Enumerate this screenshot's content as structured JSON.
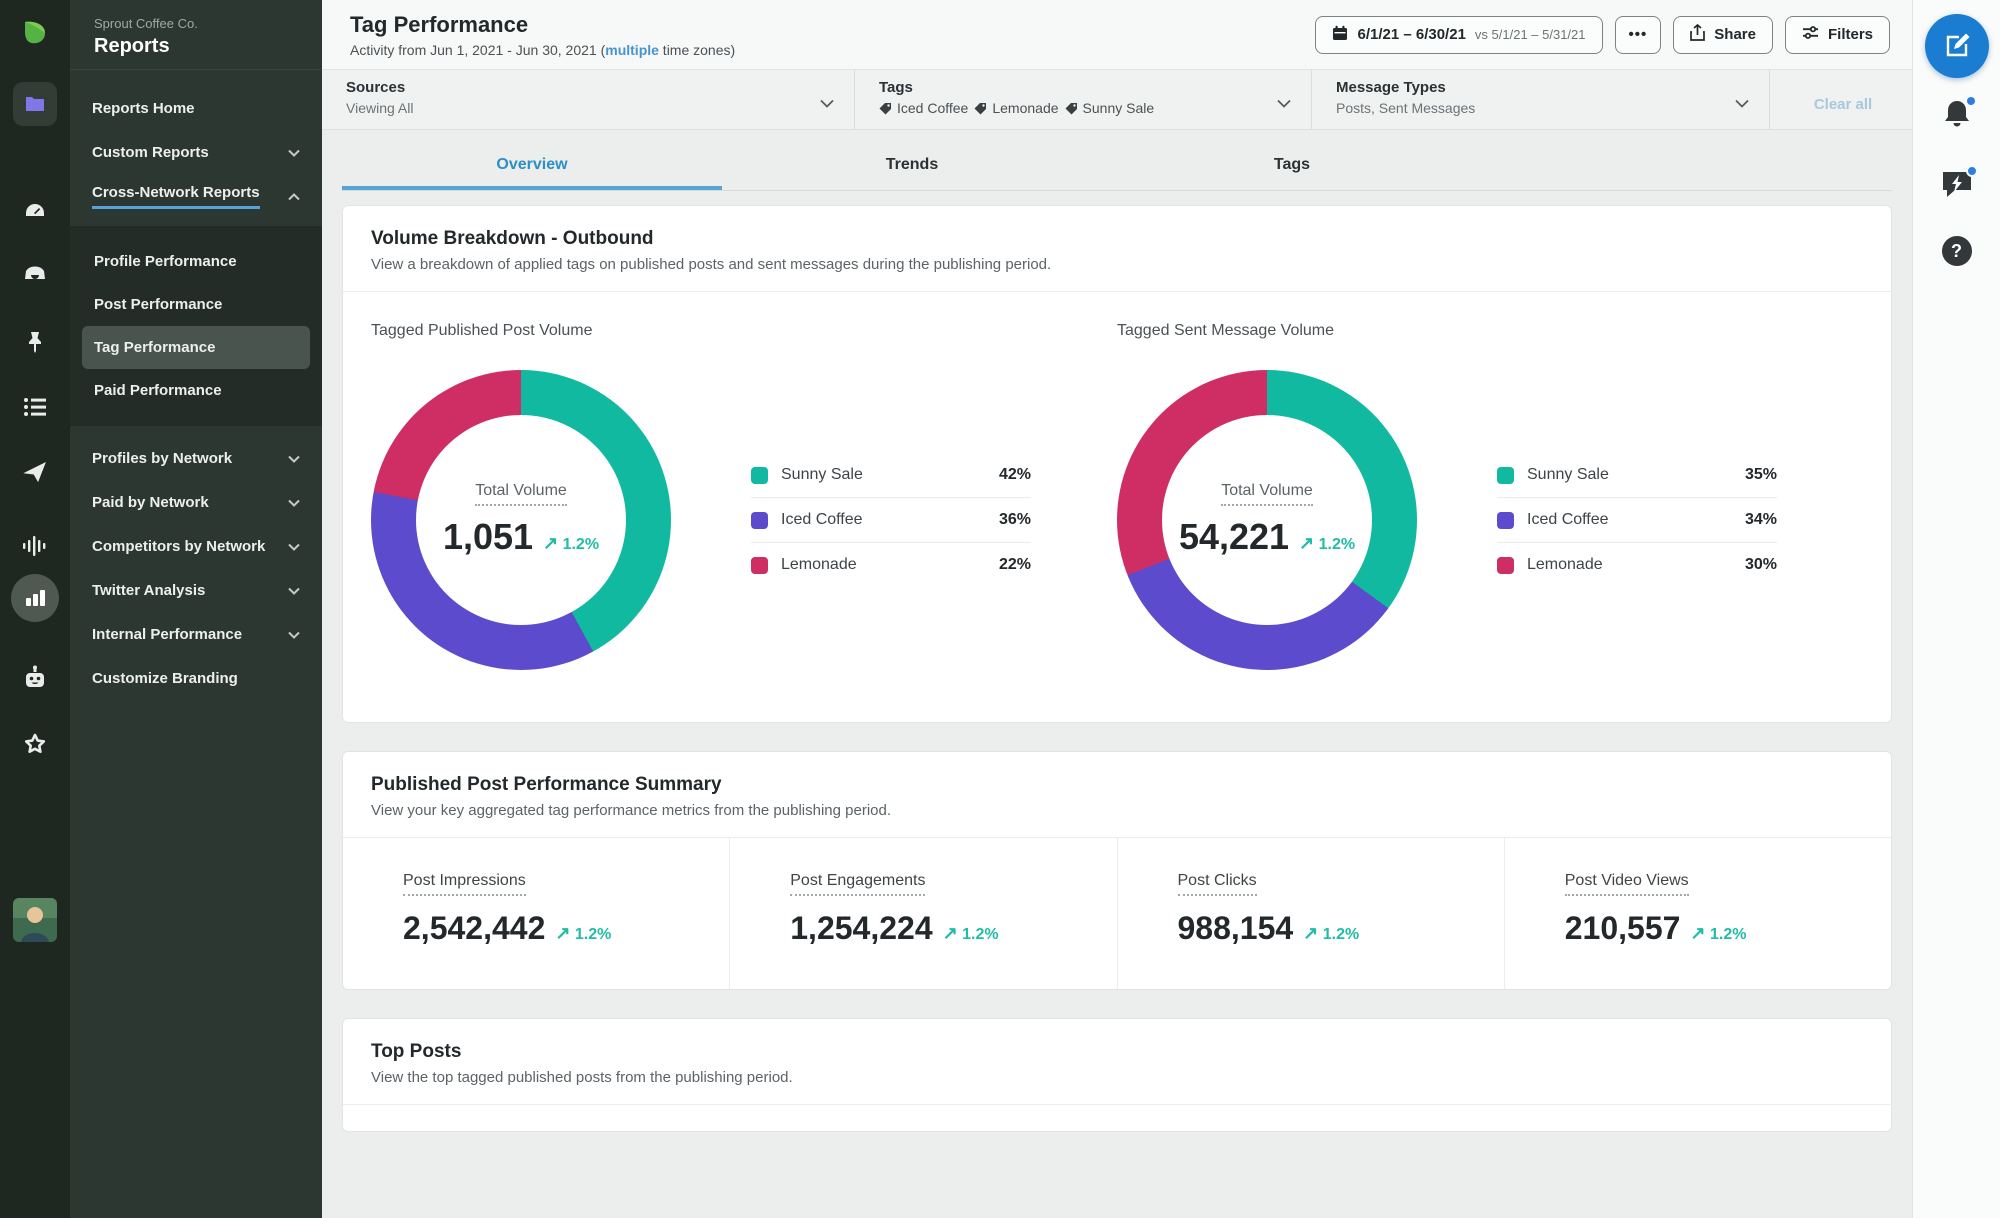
{
  "colors": {
    "teal": "#10B9A0",
    "purple": "#5D4BCD",
    "pink": "#CE2E63",
    "accent_blue": "#2E8FC4",
    "underline_blue": "#54A4D6",
    "link_blue": "#4795CE",
    "compose_blue": "#1A7DD2",
    "delta_teal": "#21BCA5",
    "sidebar_bg": "#2D3731",
    "rail_bg": "#1F2721"
  },
  "icons": {
    "trend_up": "↗",
    "more": "•••"
  },
  "icon_rail": [
    "sprout-logo",
    "folder",
    "gauge",
    "inbox",
    "pin",
    "list",
    "paper-plane",
    "waveform",
    "bar-chart",
    "bot",
    "star",
    "avatar"
  ],
  "sidebar": {
    "company": "Sprout Coffee Co.",
    "title": "Reports",
    "items_top": [
      {
        "label": "Reports Home"
      },
      {
        "label": "Custom Reports"
      },
      {
        "label": "Cross-Network Reports"
      }
    ],
    "sub_items": [
      {
        "label": "Profile Performance"
      },
      {
        "label": "Post Performance"
      },
      {
        "label": "Tag Performance"
      },
      {
        "label": "Paid Performance"
      }
    ],
    "items_bottom": [
      {
        "label": "Profiles by Network"
      },
      {
        "label": "Paid by Network"
      },
      {
        "label": "Competitors by Network"
      },
      {
        "label": "Twitter Analysis"
      },
      {
        "label": "Internal Performance"
      },
      {
        "label": "Customize Branding"
      }
    ]
  },
  "header": {
    "title": "Tag Performance",
    "subtitle_prefix": "Activity from Jun 1, 2021 - Jun 30, 2021 (",
    "subtitle_link": "multiple",
    "subtitle_suffix": " time zones)",
    "date_range": "6/1/21 – 6/30/21",
    "date_compare": "vs 5/1/21 – 5/31/21",
    "share_label": "Share",
    "filters_label": "Filters"
  },
  "filter_bar": {
    "sources": {
      "label": "Sources",
      "value": "Viewing All"
    },
    "tags": {
      "label": "Tags",
      "values": [
        "Iced Coffee",
        "Lemonade",
        "Sunny Sale"
      ]
    },
    "message_types": {
      "label": "Message Types",
      "value": "Posts, Sent Messages"
    },
    "clear_all": "Clear all"
  },
  "tabs": [
    {
      "label": "Overview",
      "active": true
    },
    {
      "label": "Trends",
      "active": false
    },
    {
      "label": "Tags",
      "active": false
    }
  ],
  "volume_card": {
    "title": "Volume Breakdown - Outbound",
    "subtitle": "View a breakdown of applied tags on published posts and sent messages during the publishing period."
  },
  "chart_data": [
    {
      "type": "pie",
      "title": "Tagged Published Post Volume",
      "center_label": "Total Volume",
      "total": "1,051",
      "delta": "1.2%",
      "segments": [
        {
          "label": "Sunny Sale",
          "value": 42,
          "display": "42%",
          "color": "#10B9A0"
        },
        {
          "label": "Iced Coffee",
          "value": 36,
          "display": "36%",
          "color": "#5D4BCD"
        },
        {
          "label": "Lemonade",
          "value": 22,
          "display": "22%",
          "color": "#CE2E63"
        }
      ]
    },
    {
      "type": "pie",
      "title": "Tagged Sent Message Volume",
      "center_label": "Total Volume",
      "total": "54,221",
      "delta": "1.2%",
      "segments": [
        {
          "label": "Sunny Sale",
          "value": 35,
          "display": "35%",
          "color": "#10B9A0"
        },
        {
          "label": "Iced Coffee",
          "value": 34,
          "display": "34%",
          "color": "#5D4BCD"
        },
        {
          "label": "Lemonade",
          "value": 30,
          "display": "30%",
          "color": "#CE2E63"
        }
      ]
    }
  ],
  "summary_card": {
    "title": "Published Post Performance Summary",
    "subtitle": "View your key aggregated tag performance metrics from the publishing period.",
    "metrics": [
      {
        "label": "Post Impressions",
        "value": "2,542,442",
        "delta": "1.2%"
      },
      {
        "label": "Post Engagements",
        "value": "1,254,224",
        "delta": "1.2%"
      },
      {
        "label": "Post Clicks",
        "value": "988,154",
        "delta": "1.2%"
      },
      {
        "label": "Post Video Views",
        "value": "210,557",
        "delta": "1.2%"
      }
    ]
  },
  "top_posts_card": {
    "title": "Top Posts",
    "subtitle": "View the top tagged published posts from the publishing period."
  }
}
